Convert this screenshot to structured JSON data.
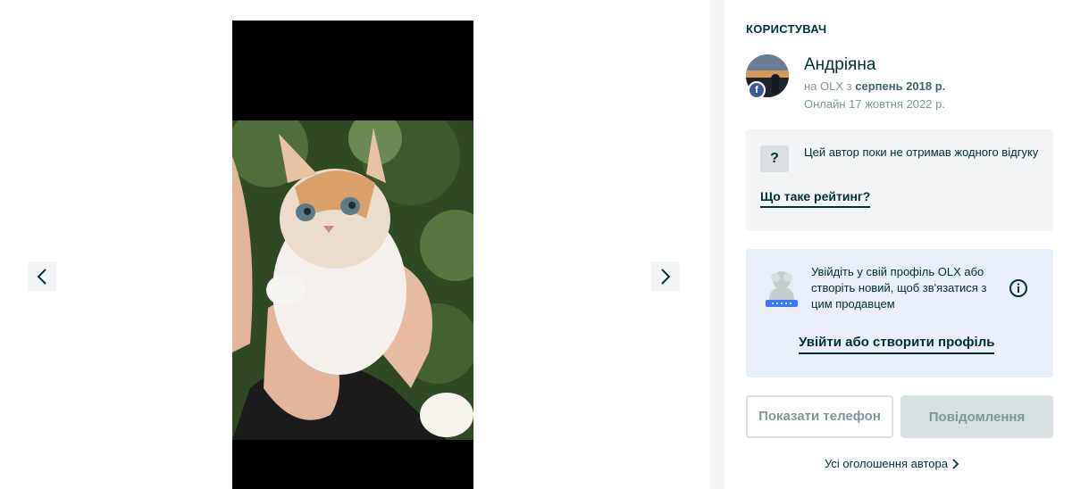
{
  "gallery": {
    "prev_icon": "chevron-left-icon",
    "next_icon": "chevron-right-icon",
    "photo_icon": "kitten-photo"
  },
  "user": {
    "section_title": "КОРИСТУВАЧ",
    "name": "Андріяна",
    "since_prefix": "на OLX з",
    "since_date": "серпень 2018 р.",
    "online": "Онлайн 17 жовтня 2022 р.",
    "badge_letter": "f",
    "badge_icon": "facebook-icon"
  },
  "rating": {
    "icon_glyph": "?",
    "text": "Цей автор поки не отримав жодного відгуку",
    "link": "Що таке рейтинг?"
  },
  "login": {
    "text": "Увійдіть у свій профіль OLX або створіть новий, щоб зв'язатися з цим продавцем",
    "link": "Увійти або створити профіль",
    "info_icon": "info-icon"
  },
  "actions": {
    "phone": "Показати телефон",
    "message": "Повідомлення",
    "all_ads": "Усі оголошення автора"
  },
  "colors": {
    "text": "#002f34",
    "muted": "#7f9799",
    "panel_grey": "#f2f4f5",
    "panel_blue": "#e8effb",
    "facebook": "#3b5998"
  }
}
